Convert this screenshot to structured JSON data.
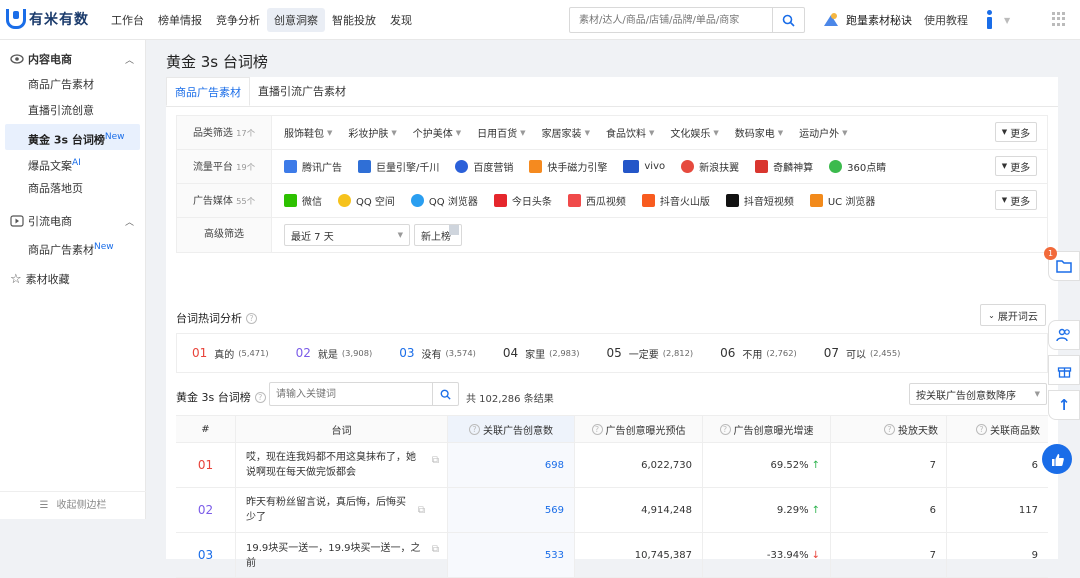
{
  "brand": {
    "name": "有米有数"
  },
  "nav": [
    "工作台",
    "榜单情报",
    "竞争分析",
    "创意洞察",
    "智能投放",
    "发现"
  ],
  "search": {
    "placeholder": "素材/达人/商品/店铺/品牌/单品/商家"
  },
  "header_right": {
    "link1": "跑量素材秘诀",
    "link2": "使用教程"
  },
  "sidebar": {
    "group1": "内容电商",
    "items1": [
      {
        "label": "商品广告素材",
        "sup": ""
      },
      {
        "label": "直播引流创意",
        "sup": ""
      },
      {
        "label": "黄金 3s 台词榜",
        "sup": "New"
      },
      {
        "label": "爆品文案",
        "sup": "AI"
      },
      {
        "label": "商品落地页",
        "sup": ""
      }
    ],
    "group2": "引流电商",
    "items2": [
      {
        "label": "商品广告素材",
        "sup": "New"
      }
    ],
    "group3": "素材收藏",
    "footer": "收起侧边栏"
  },
  "page_title": "黄金 3s 台词榜",
  "tabs": [
    "商品广告素材",
    "直播引流广告素材"
  ],
  "filters": {
    "category": {
      "label": "品类筛选",
      "count": "17个",
      "options": [
        "服饰鞋包",
        "彩妆护肤",
        "个护美体",
        "日用百货",
        "家居家装",
        "食品饮料",
        "文化娱乐",
        "数码家电",
        "运动户外"
      ],
      "more": "更多"
    },
    "platform": {
      "label": "流量平台",
      "count": "19个",
      "options": [
        "腾讯广告",
        "巨量引擎/千川",
        "百度营销",
        "快手磁力引擎",
        "vivo",
        "新浪扶翼",
        "奇麟神算",
        "360点睛"
      ],
      "more": "更多"
    },
    "media": {
      "label": "广告媒体",
      "count": "55个",
      "options": [
        "微信",
        "QQ 空间",
        "QQ 浏览器",
        "今日头条",
        "西瓜视频",
        "抖音火山版",
        "抖音短视频",
        "UC 浏览器"
      ],
      "more": "更多"
    },
    "advanced": {
      "label": "高级筛选",
      "date": "最近 7 天",
      "new": "新上榜"
    }
  },
  "hot_words": {
    "title": "台词热词分析",
    "expand": "展开词云",
    "items": [
      {
        "rank": "01",
        "word": "真的",
        "count": "(5,471)",
        "color": "#e8433a"
      },
      {
        "rank": "02",
        "word": "就是",
        "count": "(3,908)",
        "color": "#7b5ce8"
      },
      {
        "rank": "03",
        "word": "没有",
        "count": "(3,574)",
        "color": "#1a6de8"
      },
      {
        "rank": "04",
        "word": "家里",
        "count": "(2,983)",
        "color": "#333333"
      },
      {
        "rank": "05",
        "word": "一定要",
        "count": "(2,812)",
        "color": "#333333"
      },
      {
        "rank": "06",
        "word": "不用",
        "count": "(2,762)",
        "color": "#333333"
      },
      {
        "rank": "07",
        "word": "可以",
        "count": "(2,455)",
        "color": "#333333"
      }
    ]
  },
  "ranking": {
    "title": "黄金 3s 台词榜",
    "search_placeholder": "请输入关键词",
    "result": "共 102,286 条结果",
    "sort": "按关联广告创意数降序",
    "columns": [
      "#",
      "台词",
      "关联广告创意数",
      "广告创意曝光预估",
      "广告创意曝光增速",
      "投放天数",
      "关联商品数"
    ],
    "rows": [
      {
        "rank": "01",
        "line": "哎，现在连我妈都不用这臭抹布了，她说啊现在每天做完饭都会",
        "ads": "698",
        "exposure": "6,022,730",
        "growth": "69.52%",
        "dir": "up",
        "days": "7",
        "products": "6"
      },
      {
        "rank": "02",
        "line": "昨天有粉丝留言说，真后悔，后悔买少了",
        "ads": "569",
        "exposure": "4,914,248",
        "growth": "9.29%",
        "dir": "up",
        "days": "6",
        "products": "117"
      },
      {
        "rank": "03",
        "line": "19.9块买一送一，19.9块买一送一，之前",
        "ads": "533",
        "exposure": "10,745,387",
        "growth": "-33.94%",
        "dir": "down",
        "days": "7",
        "products": "9"
      }
    ]
  },
  "badge": "1",
  "colors": {
    "accent": "#1a6de8",
    "up": "#2bb24c",
    "down": "#e8433a"
  }
}
